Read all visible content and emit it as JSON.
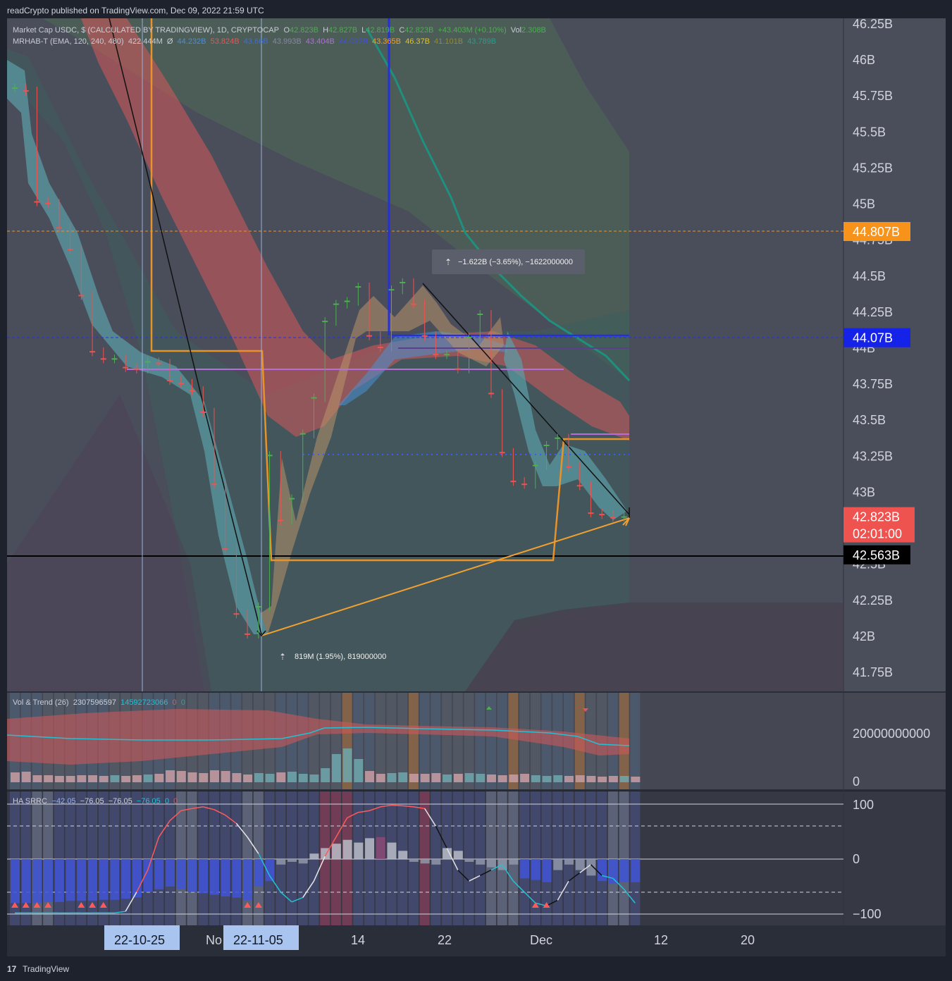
{
  "header": {
    "publisher": "readCrypto published on TradingView.com, Dec 09, 2022 21:59 UTC",
    "footer_brand": "TradingView"
  },
  "legend": {
    "main_title": "Market Cap USDC, $ (CALCULATED BY TRADINGVIEW), 1D, CRYPTOCAP",
    "ohlc": [
      {
        "label": "O",
        "value": "42.823B"
      },
      {
        "label": "H",
        "value": "42.827B"
      },
      {
        "label": "L",
        "value": "42.819B"
      },
      {
        "label": "C",
        "value": "42.823B"
      }
    ],
    "change": "+43.403M (+0.10%)",
    "vol_label": "Vol",
    "vol_value": "2.308B",
    "indicator_name": "MRHAB-T (EMA, 120, 240, 480)",
    "indicator_first": "422.444M",
    "indicator_sym": "Ø",
    "indicator_values": [
      {
        "value": "44.232B",
        "color": "#4b8fd6"
      },
      {
        "value": "53.824B",
        "color": "#ef5350"
      },
      {
        "value": "43.66B",
        "color": "#3f6fd1"
      },
      {
        "value": "43.993B",
        "color": "#8a86a8"
      },
      {
        "value": "43.404B",
        "color": "#b36ed8"
      },
      {
        "value": "44.082B",
        "color": "#3d4ff0"
      },
      {
        "value": "43.365B",
        "color": "#f0a030"
      },
      {
        "value": "46.37B",
        "color": "#e8c21b"
      },
      {
        "value": "41.101B",
        "color": "#8f8b3c"
      },
      {
        "value": "43.789B",
        "color": "#2a9e8c"
      }
    ]
  },
  "measurements": [
    {
      "text": "−1.622B (−3.65%), −1622000000"
    },
    {
      "text": "819M (1.95%), 819000000"
    }
  ],
  "price_axis": {
    "ticks": [
      "46.25B",
      "46B",
      "45.75B",
      "45.5B",
      "45.25B",
      "45B",
      "44.75B",
      "44.5B",
      "44.25B",
      "44B",
      "43.75B",
      "43.5B",
      "43.25B",
      "43B",
      "42.75B",
      "42.5B",
      "42.25B",
      "42B",
      "41.75B"
    ],
    "tick_values": [
      46.25,
      46.0,
      45.75,
      45.5,
      45.25,
      45.0,
      44.75,
      44.5,
      44.25,
      44.0,
      43.75,
      43.5,
      43.25,
      43.0,
      42.75,
      42.5,
      42.25,
      42.0,
      41.75
    ],
    "labels": [
      {
        "text": "44.807B",
        "color": "#f7931a",
        "value": 44.807
      },
      {
        "text": "44.07B",
        "color": "#1522e8",
        "value": 44.07
      },
      {
        "text": "42.823B",
        "sub": "02:01:00",
        "color": "#ef5350",
        "value": 42.823
      },
      {
        "text": "42.563B",
        "color": "#000000",
        "value": 42.563
      }
    ]
  },
  "vol_panel": {
    "title": "Vol & Trend (26)",
    "values": [
      {
        "value": "2307596597",
        "color": "#cfd2da"
      },
      {
        "value": "14592723066",
        "color": "#22c1d4"
      },
      {
        "value": "0",
        "color": "#ef5350"
      },
      {
        "value": "0",
        "color": "#26a69a"
      }
    ],
    "axis_ticks": [
      "20000000000",
      "0"
    ]
  },
  "srrc_panel": {
    "title": "HA SRRC",
    "values": [
      {
        "value": "−42.05",
        "color": "#9bb0e8"
      },
      {
        "value": "−76.05",
        "color": "#cfd2da"
      },
      {
        "value": "−76.05",
        "color": "#cfd2da"
      },
      {
        "value": "−76.05",
        "color": "#22c1d4"
      },
      {
        "value": "0",
        "color": "#22c1d4"
      },
      {
        "value": "0",
        "color": "#ef5350"
      }
    ],
    "axis_ticks": [
      "100",
      "0",
      "−100"
    ]
  },
  "time_axis": {
    "ticks": [
      "No",
      "14",
      "22",
      "Dec",
      "12",
      "20"
    ],
    "highlights": [
      "22-10-25",
      "22-11-05"
    ]
  },
  "chart_data": {
    "type": "line",
    "x": [
      "2022-10-15",
      "2022-10-16",
      "2022-10-17",
      "2022-10-18",
      "2022-10-19",
      "2022-10-20",
      "2022-10-21",
      "2022-10-22",
      "2022-10-23",
      "2022-10-24",
      "2022-10-25",
      "2022-10-26",
      "2022-10-27",
      "2022-10-28",
      "2022-10-29",
      "2022-10-30",
      "2022-10-31",
      "2022-11-01",
      "2022-11-02",
      "2022-11-03",
      "2022-11-04",
      "2022-11-05",
      "2022-11-06",
      "2022-11-07",
      "2022-11-08",
      "2022-11-09",
      "2022-11-10",
      "2022-11-11",
      "2022-11-12",
      "2022-11-13",
      "2022-11-14",
      "2022-11-15",
      "2022-11-16",
      "2022-11-17",
      "2022-11-18",
      "2022-11-19",
      "2022-11-20",
      "2022-11-21",
      "2022-11-22",
      "2022-11-23",
      "2022-11-24",
      "2022-11-25",
      "2022-11-26",
      "2022-11-27",
      "2022-11-28",
      "2022-11-29",
      "2022-11-30",
      "2022-12-01",
      "2022-12-02",
      "2022-12-03",
      "2022-12-04",
      "2022-12-05",
      "2022-12-06",
      "2022-12-07",
      "2022-12-08",
      "2022-12-09"
    ],
    "series": [
      {
        "values": [
          45.8,
          45.78,
          45.01,
          45.0,
          44.83,
          44.68,
          44.36,
          43.97,
          43.92,
          43.92,
          43.86,
          43.85,
          43.9,
          43.89,
          43.77,
          43.75,
          43.7,
          43.55,
          43.05,
          42.6,
          42.15,
          42.01,
          42.2,
          43.25,
          42.8,
          42.95,
          43.4,
          43.65,
          44.18,
          44.3,
          44.32,
          44.42,
          44.08,
          44.0,
          44.4,
          44.45,
          44.3,
          44.08,
          43.95,
          43.95,
          43.85,
          44.07,
          44.23,
          43.68,
          43.27,
          43.07,
          43.05,
          43.18,
          43.32,
          43.37,
          43.17,
          43.04,
          42.85,
          42.84,
          42.82,
          42.823
        ]
      }
    ],
    "ylim": [
      41.68,
      46.32
    ],
    "grid": false,
    "legend": "top-left"
  }
}
